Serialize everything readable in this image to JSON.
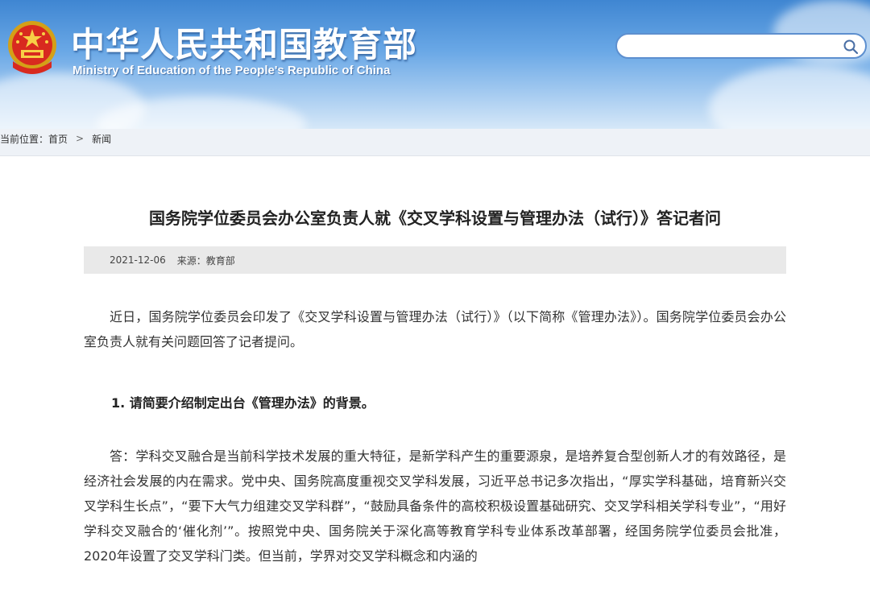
{
  "header": {
    "title": "中华人民共和国教育部",
    "subtitle": "Ministry of Education of the People's Republic of China",
    "emblem_icon": "national-emblem-icon"
  },
  "search": {
    "value": "",
    "placeholder": "",
    "icon": "search-icon"
  },
  "breadcrumb": {
    "label": "当前位置：",
    "home": "首页",
    "separator": ">",
    "current": "新闻"
  },
  "article": {
    "title": "国务院学位委员会办公室负责人就《交叉学科设置与管理办法（试行）》答记者问",
    "date": "2021-12-06",
    "source": "来源：教育部",
    "intro": "近日，国务院学位委员会印发了《交叉学科设置与管理办法（试行）》（以下简称《管理办法》）。国务院学位委员会办公室负责人就有关问题回答了记者提问。",
    "question1": "1. 请简要介绍制定出台《管理办法》的背景。",
    "answer1": "答：学科交叉融合是当前科学技术发展的重大特征，是新学科产生的重要源泉，是培养复合型创新人才的有效路径，是经济社会发展的内在需求。党中央、国务院高度重视交叉学科发展，习近平总书记多次指出，“厚实学科基础，培育新兴交叉学科生长点”，“要下大气力组建交叉学科群”，“鼓励具备条件的高校积极设置基础研究、交叉学科相关学科专业”，“用好学科交叉融合的‘催化剂’”。按照党中央、国务院关于深化高等教育学科专业体系改革部署，经国务院学位委员会批准，2020年设置了交叉学科门类。但当前，学界对交叉学科概念和内涵的"
  },
  "colors": {
    "header_blue": "#3f86d2",
    "meta_bar_bg": "#e9e9e9",
    "search_border": "#5d8fcf"
  }
}
